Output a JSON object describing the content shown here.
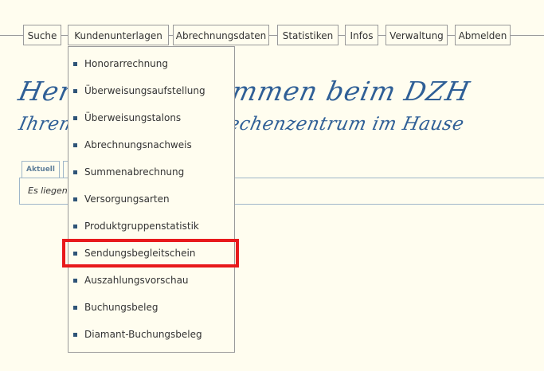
{
  "nav": {
    "items": [
      {
        "label": "Suche"
      },
      {
        "label": "Kundenunterlagen"
      },
      {
        "label": "Abrechnungsdaten"
      },
      {
        "label": "Statistiken"
      },
      {
        "label": "Infos"
      },
      {
        "label": "Verwaltung"
      },
      {
        "label": "Abmelden"
      }
    ]
  },
  "headline": {
    "line1": "Herzlich willkommen beim DZH",
    "line2": "Ihrem persönlichen Rechenzentrum im Hause"
  },
  "tabs": [
    {
      "label": "Aktuell"
    },
    {
      "label": ""
    }
  ],
  "panel": {
    "text": "Es liegen keine neuen Nachrichten vor."
  },
  "dropdown": {
    "items": [
      {
        "label": "Honorarrechnung"
      },
      {
        "label": "Überweisungsaufstellung"
      },
      {
        "label": "Überweisungstalons"
      },
      {
        "label": "Abrechnungsnachweis"
      },
      {
        "label": "Summenabrechnung"
      },
      {
        "label": "Versorgungsarten"
      },
      {
        "label": "Produktgruppenstatistik"
      },
      {
        "label": "Sendungsbegleitschein"
      },
      {
        "label": "Auszahlungsvorschau"
      },
      {
        "label": "Buchungsbeleg"
      },
      {
        "label": "Diamant-Buchungsbeleg"
      }
    ]
  },
  "colors": {
    "background": "#fffdef",
    "accent": "#2f5f96",
    "highlight": "#e8191c"
  }
}
